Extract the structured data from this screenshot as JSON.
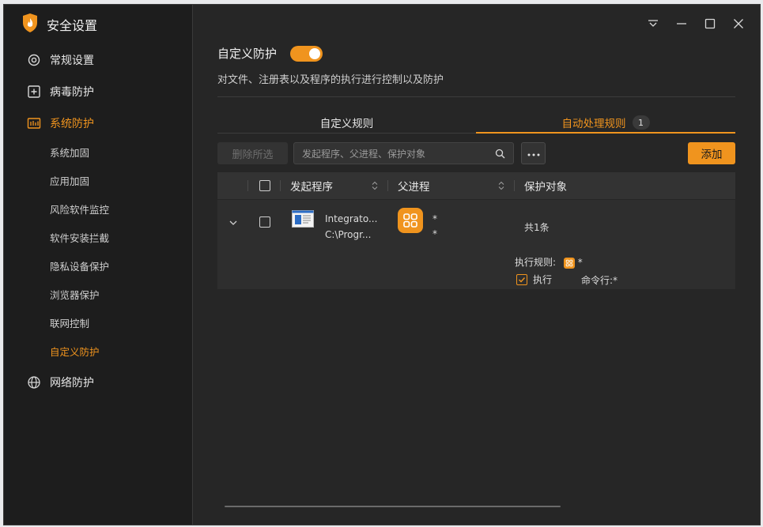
{
  "app": {
    "title": "安全设置"
  },
  "sidebar": {
    "items": [
      {
        "label": "常规设置",
        "icon": "gear-icon"
      },
      {
        "label": "病毒防护",
        "icon": "plus-square-icon"
      },
      {
        "label": "系统防护",
        "icon": "system-icon",
        "active": true
      },
      {
        "label": "网络防护",
        "icon": "globe-icon"
      }
    ],
    "sub_items": [
      {
        "label": "系统加固"
      },
      {
        "label": "应用加固"
      },
      {
        "label": "风险软件监控"
      },
      {
        "label": "软件安装拦截"
      },
      {
        "label": "隐私设备保护"
      },
      {
        "label": "浏览器保护"
      },
      {
        "label": "联网控制"
      },
      {
        "label": "自定义防护",
        "active": true
      }
    ]
  },
  "window_controls": [
    "menu-icon",
    "minimize-icon",
    "maximize-icon",
    "close-icon"
  ],
  "page": {
    "title": "自定义防护",
    "toggle_on": true,
    "description": "对文件、注册表以及程序的执行进行控制以及防护"
  },
  "tabs": [
    {
      "label": "自定义规则",
      "active": false
    },
    {
      "label": "自动处理规则",
      "active": true,
      "badge": "1"
    }
  ],
  "toolbar": {
    "delete_label": "删除所选",
    "search_placeholder": "发起程序、父进程、保护对象",
    "add_label": "添加"
  },
  "table": {
    "headers": {
      "initiator": "发起程序",
      "parent": "父进程",
      "target": "保护对象"
    },
    "rows": [
      {
        "initiator_name": "Integrato...",
        "initiator_path": "C:\\Progr...",
        "parent_line1": "*",
        "parent_line2": "*",
        "target": "共1条",
        "detail": {
          "rule_label": "执行规则:",
          "rule_value": "*",
          "action_label": "执行",
          "cmd_label": "命令行:",
          "cmd_value": "*"
        }
      }
    ]
  },
  "colors": {
    "accent": "#f0941e",
    "background": "#262626",
    "sidebar": "#1d1d1d"
  }
}
